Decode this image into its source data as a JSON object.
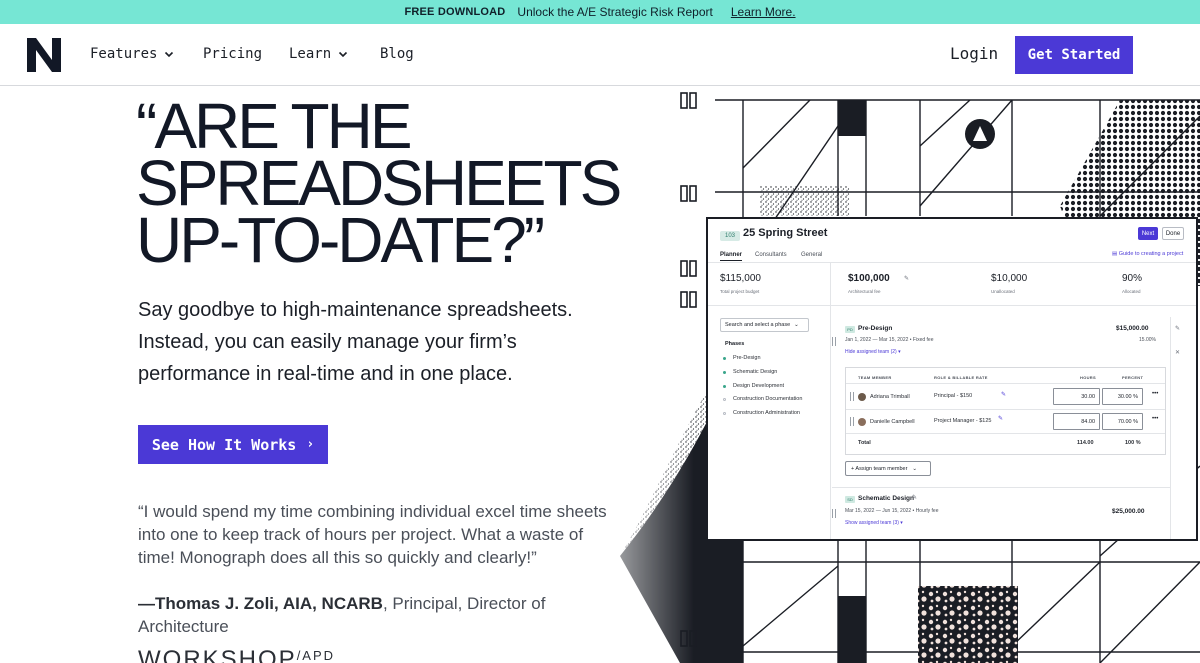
{
  "banner": {
    "tag": "FREE DOWNLOAD",
    "message": "Unlock the A/E Strategic Risk Report",
    "link": "Learn More."
  },
  "nav": {
    "items": [
      {
        "label": "Features",
        "has_dropdown": true
      },
      {
        "label": "Pricing",
        "has_dropdown": false
      },
      {
        "label": "Learn",
        "has_dropdown": true
      },
      {
        "label": "Blog",
        "has_dropdown": false
      }
    ],
    "login": "Login",
    "cta": "Get Started",
    "icons": {
      "logo": "monograph-logo",
      "dropdown": "chevron-down-icon"
    }
  },
  "hero": {
    "headline_lines": [
      "“ARE THE",
      "SPREADSHEETS",
      "UP-TO-DATE?”"
    ],
    "subheading": "Say goodbye to high-maintenance spreadsheets. Instead, you can easily manage your firm’s performance in real-time and in one place.",
    "cta": "See How It Works",
    "cta_arrow": "›",
    "quote": "“I would spend my time combining individual excel time sheets into one to keep track of hours per project. What a waste of time! Monograph does all this so quickly and clearly!”",
    "attribution_name": "—Thomas J. Zoli, AIA, NCARB",
    "attribution_role": ", Principal, Director of Architecture",
    "client_logo": "WORKSHOP",
    "client_logo_sup": "/APD"
  },
  "app": {
    "project_number": "103",
    "project_name": "25 Spring Street",
    "buttons": {
      "next": "Next",
      "done": "Done"
    },
    "tabs": [
      "Planner",
      "Consultants",
      "General"
    ],
    "active_tab": "Planner",
    "guide_link": "Guide to creating a project",
    "stats": [
      {
        "value": "$115,000",
        "label": "Total project budget",
        "bold": false
      },
      {
        "value": "$100,000",
        "label": "Architectural fee",
        "bold": true
      },
      {
        "value": "$10,000",
        "label": "Unallocated",
        "bold": false
      },
      {
        "value": "90%",
        "label": "Allocated",
        "bold": false
      }
    ],
    "phase_search_placeholder": "Search and select a phase",
    "phases_heading": "Phases",
    "phases": [
      {
        "name": "Pre-Design",
        "active": true
      },
      {
        "name": "Schematic Design",
        "active": true
      },
      {
        "name": "Design Development",
        "active": true
      },
      {
        "name": "Construction Documentation",
        "active": false
      },
      {
        "name": "Construction Administration",
        "active": false
      }
    ],
    "phase_detail": {
      "badge": "PD",
      "name": "Pre-Design",
      "amount": "$15,000.00",
      "dates": "Jan 1, 2022 — Mar 15, 2022",
      "fee_type": "Fixed fee",
      "percent": "15.00%",
      "toggle_link": "Hide assigned team (2)",
      "table_headers": [
        "TEAM MEMBER",
        "ROLE & BILLABLE RATE",
        "HOURS",
        "PERCENT"
      ],
      "rows": [
        {
          "name": "Adriana Trimball",
          "role": "Principal - $150",
          "hours": "30.00",
          "percent": "30.00 %"
        },
        {
          "name": "Danielle Campbell",
          "role": "Project Manager - $125",
          "hours": "84.00",
          "percent": "70.00 %"
        }
      ],
      "total_label": "Total",
      "total_hours": "114.00",
      "total_percent": "100 %",
      "assign_button": "+ Assign team member"
    },
    "phase_detail_2": {
      "badge": "SD",
      "name": "Schematic Design",
      "dates": "Mar 15, 2022 — Jun 15, 2022",
      "fee_type": "Hourly fee",
      "amount": "$25,000.00",
      "toggle_link": "Show assigned team (3)"
    }
  },
  "colors": {
    "banner": "#76e6d4",
    "accent": "#4b39d6",
    "ink": "#121826",
    "teal": "#3aa58b"
  }
}
